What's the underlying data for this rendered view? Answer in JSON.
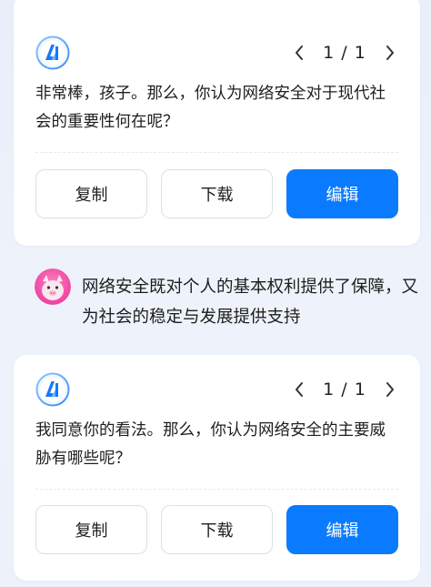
{
  "card1": {
    "pager": "1 / 1",
    "message": "非常棒，孩子。那么，你认为网络安全对于现代社会的重要性何在呢？",
    "buttons": {
      "copy": "复制",
      "download": "下载",
      "edit": "编辑"
    }
  },
  "reply": {
    "avatar_icon": "pig-avatar-icon",
    "text": "网络安全既对个人的基本权利提供了保障，又为社会的稳定与发展提供支持"
  },
  "card2": {
    "pager": "1 / 1",
    "message": "我同意你的看法。那么，你认为网络安全的主要威胁有哪些呢？",
    "buttons": {
      "copy": "复制",
      "download": "下载",
      "edit": "编辑"
    }
  },
  "colors": {
    "accent": "#0a7bff",
    "background": "#edf2fa",
    "card": "#ffffff",
    "button_border": "#dcdfe6"
  },
  "icons": {
    "logo": "ai-logo-icon",
    "prev": "chevron-left-icon",
    "next": "chevron-right-icon"
  }
}
